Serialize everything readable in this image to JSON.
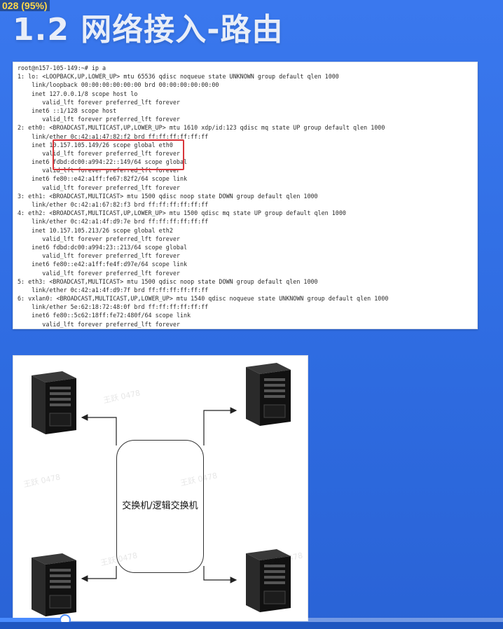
{
  "overlay": {
    "badge": "028 (95%)"
  },
  "slide": {
    "title": "1.2 网络接入-路由"
  },
  "terminal": {
    "lines": [
      "root@n157-105-149:~# ip a",
      "1: lo: <LOOPBACK,UP,LOWER_UP> mtu 65536 qdisc noqueue state UNKNOWN group default qlen 1000",
      "    link/loopback 00:00:00:00:00:00 brd 00:00:00:00:00:00",
      "    inet 127.0.0.1/8 scope host lo",
      "       valid_lft forever preferred_lft forever",
      "    inet6 ::1/128 scope host",
      "       valid_lft forever preferred_lft forever",
      "2: eth0: <BROADCAST,MULTICAST,UP,LOWER_UP> mtu 1610 xdp/id:123 qdisc mq state UP group default qlen 1000",
      "    link/ether 0c:42:a1:47:82:f2 brd ff:ff:ff:ff:ff:ff",
      "    inet 10.157.105.149/26 scope global eth0",
      "       valid_lft forever preferred_lft forever",
      "    inet6 fdbd:dc00:a994:22::149/64 scope global",
      "       valid_lft forever preferred_lft forever",
      "    inet6 fe80::e42:a1ff:fe67:82f2/64 scope link",
      "       valid_lft forever preferred_lft forever",
      "3: eth1: <BROADCAST,MULTICAST> mtu 1500 qdisc noop state DOWN group default qlen 1000",
      "    link/ether 0c:42:a1:67:82:f3 brd ff:ff:ff:ff:ff:ff",
      "4: eth2: <BROADCAST,MULTICAST,UP,LOWER_UP> mtu 1500 qdisc mq state UP group default qlen 1000",
      "    link/ether 0c:42:a1:4f:d9:7e brd ff:ff:ff:ff:ff:ff",
      "    inet 10.157.105.213/26 scope global eth2",
      "       valid_lft forever preferred_lft forever",
      "    inet6 fdbd:dc00:a994:23::213/64 scope global",
      "       valid_lft forever preferred_lft forever",
      "    inet6 fe80::e42:a1ff:fe4f:d97e/64 scope link",
      "       valid_lft forever preferred_lft forever",
      "5: eth3: <BROADCAST,MULTICAST> mtu 1500 qdisc noop state DOWN group default qlen 1000",
      "    link/ether 0c:42:a1:4f:d9:7f brd ff:ff:ff:ff:ff:ff",
      "6: vxlan0: <BROADCAST,MULTICAST,UP,LOWER_UP> mtu 1540 qdisc noqueue state UNKNOWN group default qlen 1000",
      "    link/ether 5e:62:18:72:48:0f brd ff:ff:ff:ff:ff:ff",
      "    inet6 fe80::5c62:18ff:fe72:480f/64 scope link",
      "       valid_lft forever preferred_lft forever"
    ]
  },
  "diagram": {
    "switch_label": "交换机/逻辑交换机",
    "watermarks": [
      "王跃 0478",
      "王跃 0478",
      "王跃 0478",
      "王跃 0478",
      "王跃 0478"
    ]
  },
  "player": {
    "progress": 0.13
  },
  "colors": {
    "accent": "#2f6fe4",
    "highlight": "#d8353a"
  }
}
